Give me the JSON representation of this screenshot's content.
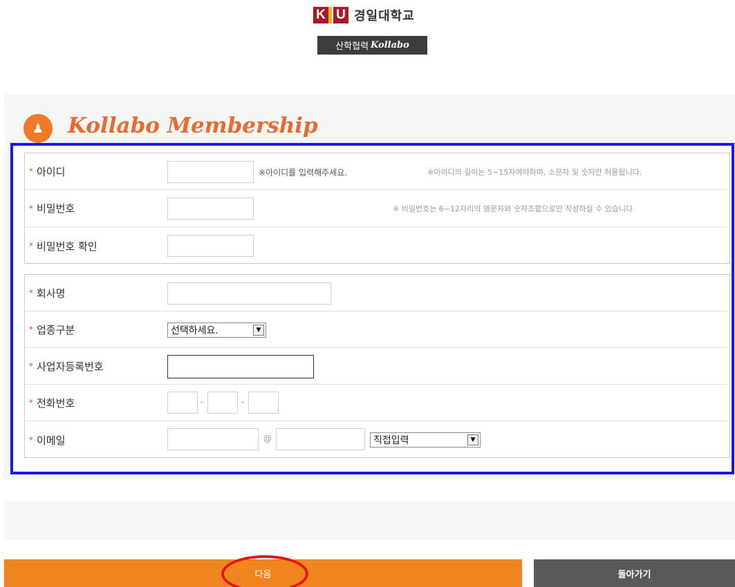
{
  "header": {
    "logo_k": "K",
    "logo_u": "U",
    "university_name": "경일대학교",
    "subtitle_main": "산학협력",
    "subtitle_em": "Kollabo"
  },
  "title": {
    "icon": "person-group-icon",
    "text": "Kollabo Membership"
  },
  "account_fields": {
    "required_mark": "*",
    "id_label": "아이디",
    "id_hint": "※아이디를 입력해주세요.",
    "id_rule": "※아이디의 길이는 5~15자여야하며, 소문자 및 숫자만 허용됩니다.",
    "password_label": "비밀번호",
    "password_rule": "※ 비밀번호는 6~12자리의 영문자와 숫자조합으로만 작성하실 수 있습니다",
    "password_confirm_label": "비밀번호 확인"
  },
  "company_fields": {
    "company_label": "회사명",
    "industry_label": "업종구분",
    "industry_selected": "선택하세요.",
    "biz_no_label": "사업자등록번호",
    "phone_label": "전화번호",
    "phone_sep": "-",
    "email_label": "이메일",
    "email_at": "@",
    "email_domain_selected": "직접입력"
  },
  "footer": {
    "next_label": "다음",
    "back_label": "돌아가기"
  },
  "colors": {
    "accent": "#f0851f",
    "highlight_frame": "#1c13f2",
    "highlight_circle": "#e61414"
  }
}
